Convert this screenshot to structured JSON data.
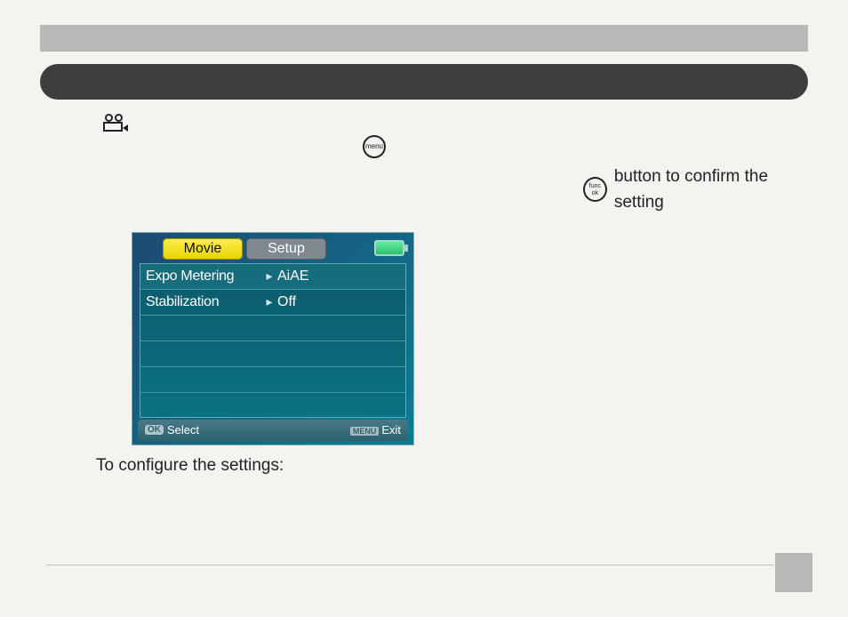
{
  "body": {
    "intro_after_icon": "",
    "func_suffix": "button to confirm the setting"
  },
  "shot": {
    "tab_active": "Movie",
    "tab_inactive": "Setup",
    "row1_label": "Expo Metering",
    "row1_value": "AiAE",
    "row2_label": "Stabilization",
    "row2_value": "Off",
    "hint_select": "Select",
    "hint_exit": "Exit",
    "hint_ok": "OK",
    "hint_menu": "MENU"
  },
  "caption": "To configure the settings:",
  "menu_btn": "menu",
  "func_btn_l1": "func",
  "func_btn_l2": "ok"
}
